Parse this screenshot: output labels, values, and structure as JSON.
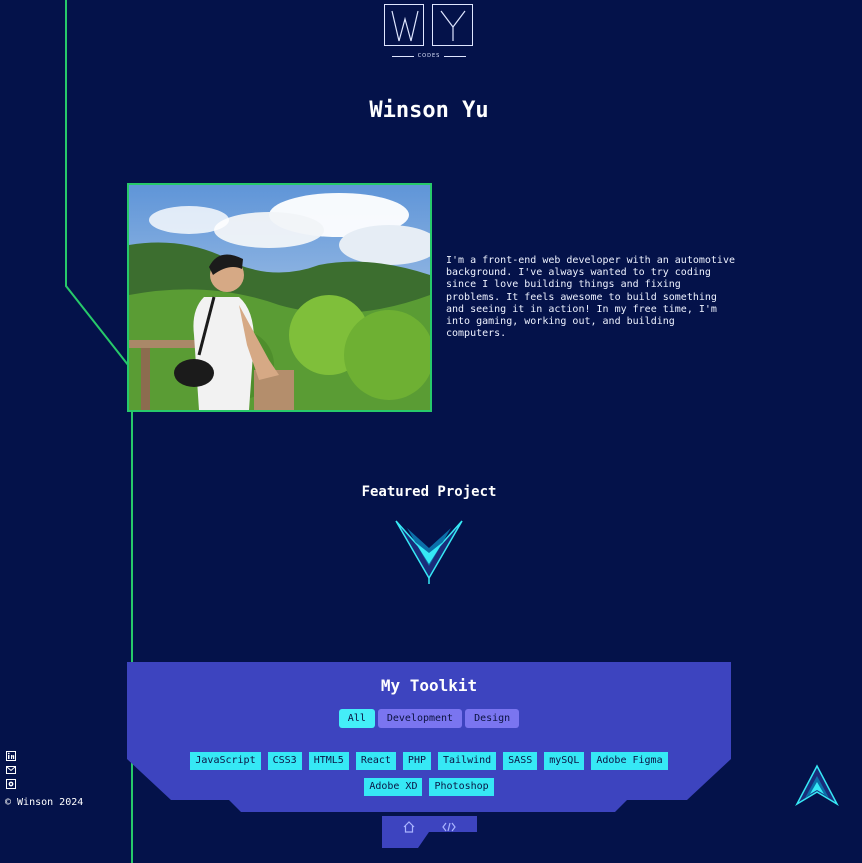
{
  "header": {
    "logo_text": "CODES",
    "name": "Winson Yu"
  },
  "about": {
    "photo_alt": "Winson Yu",
    "bio": "I'm a front-end web developer with an automotive background. I've always wanted to try coding since I love building things and fixing problems. It feels awesome to build something and seeing it in action! In my free time, I'm into gaming, working out, and building computers."
  },
  "featured": {
    "title": "Featured Project",
    "icon": "chevron-down-icon"
  },
  "toolkit": {
    "title": "My Toolkit",
    "tabs": [
      {
        "label": "All",
        "active": true
      },
      {
        "label": "Development",
        "active": false
      },
      {
        "label": "Design",
        "active": false
      }
    ],
    "skills": [
      "JavaScript",
      "CSS3",
      "HTML5",
      "React",
      "PHP",
      "Tailwind",
      "SASS",
      "mySQL",
      "Adobe Figma",
      "Adobe XD",
      "Photoshop"
    ]
  },
  "bottom_nav": {
    "items": [
      "home-icon",
      "code-icon"
    ]
  },
  "social": {
    "items": [
      "linkedin-icon",
      "mail-icon",
      "github-icon"
    ]
  },
  "footer": {
    "copyright": "© Winson 2024"
  },
  "colors": {
    "background": "#04124a",
    "circuit": "#27c96a",
    "panel": "#3d44bf",
    "accent": "#36e8f5",
    "tab": "#7a75f0"
  }
}
